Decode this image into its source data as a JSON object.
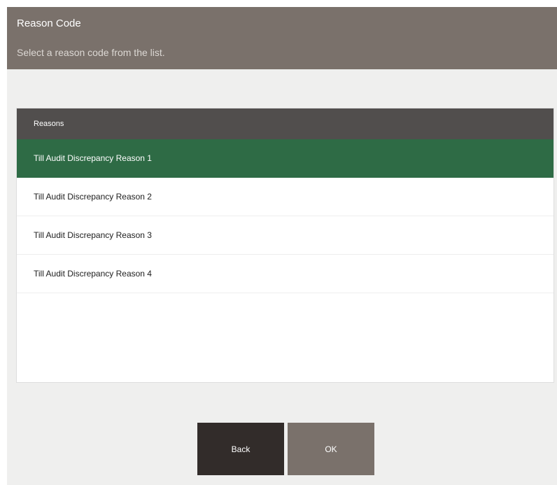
{
  "header": {
    "title": "Reason Code",
    "subtitle": "Select a reason code from the list."
  },
  "list": {
    "column_header": "Reasons",
    "selected_index": 0,
    "items": [
      {
        "label": "Till Audit Discrepancy Reason 1"
      },
      {
        "label": "Till Audit Discrepancy Reason 2"
      },
      {
        "label": "Till Audit Discrepancy Reason 3"
      },
      {
        "label": "Till Audit Discrepancy Reason 4"
      }
    ]
  },
  "buttons": {
    "back_label": "Back",
    "ok_label": "OK"
  },
  "colors": {
    "header_bg": "#7a716b",
    "list_header_bg": "#514e4d",
    "selected_row_bg": "#2e6b45",
    "back_button_bg": "#322c2a",
    "ok_button_bg": "#7a716b"
  }
}
